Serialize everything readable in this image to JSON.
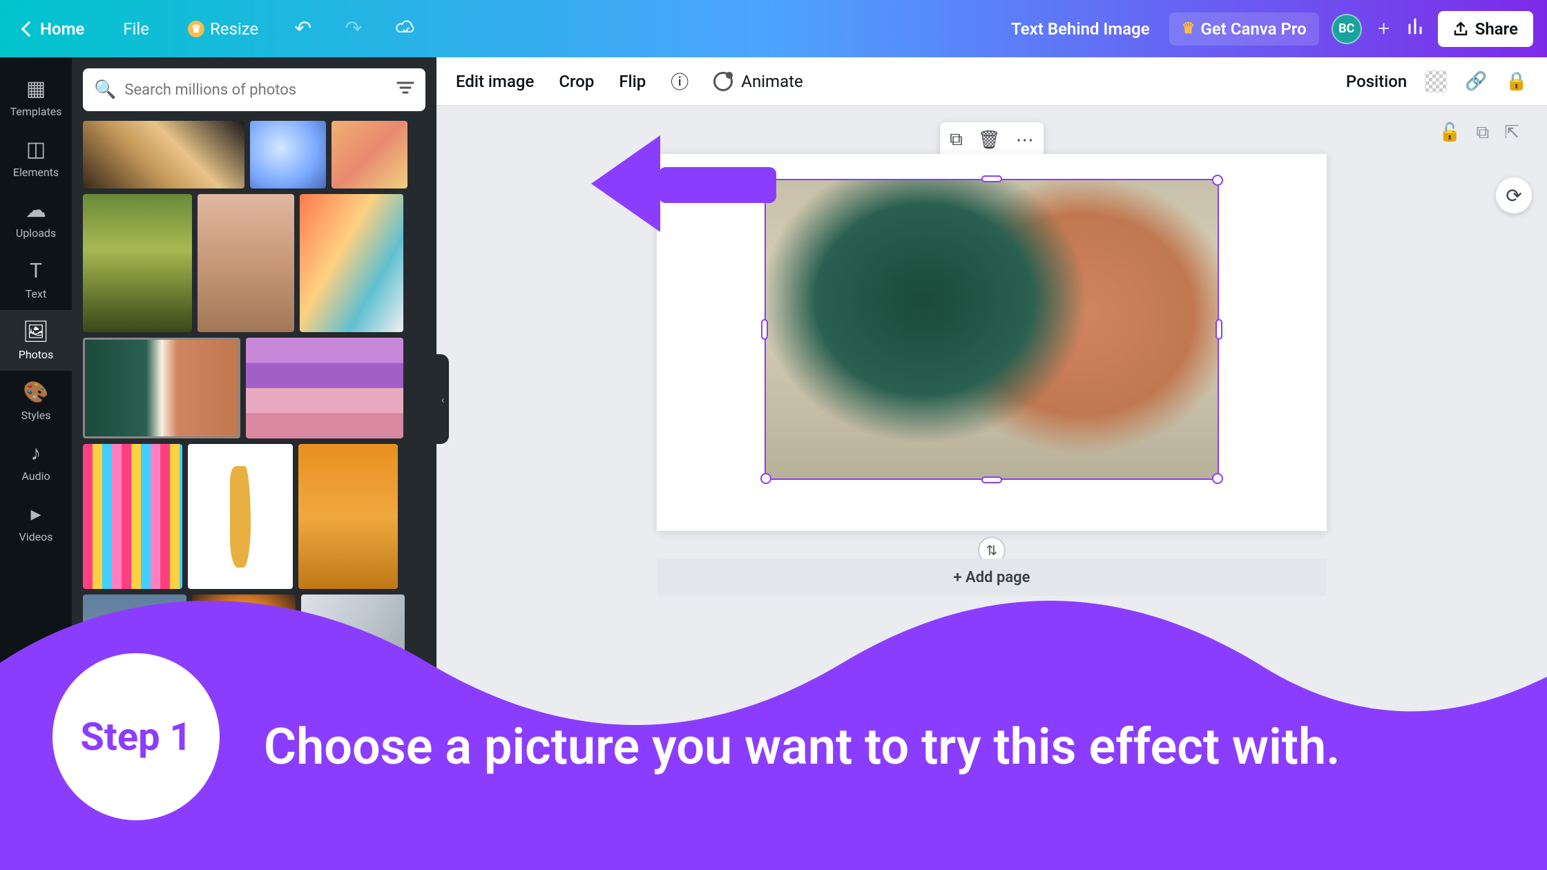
{
  "topbar": {
    "home": "Home",
    "file": "File",
    "resize": "Resize",
    "doc_name": "Text Behind Image",
    "get_pro": "Get Canva Pro",
    "avatar_initials": "BC",
    "share": "Share"
  },
  "rail": {
    "templates": "Templates",
    "elements": "Elements",
    "uploads": "Uploads",
    "text": "Text",
    "photos": "Photos",
    "styles": "Styles",
    "audio": "Audio",
    "videos": "Videos"
  },
  "search": {
    "placeholder": "Search millions of photos"
  },
  "ctx": {
    "edit_image": "Edit image",
    "crop": "Crop",
    "flip": "Flip",
    "animate": "Animate",
    "position": "Position"
  },
  "canvas": {
    "add_page": "+ Add page"
  },
  "annotation": {
    "step_label": "Step 1",
    "step_text": "Choose a picture you want to try this effect with.",
    "accent_color": "#8b3dff"
  }
}
